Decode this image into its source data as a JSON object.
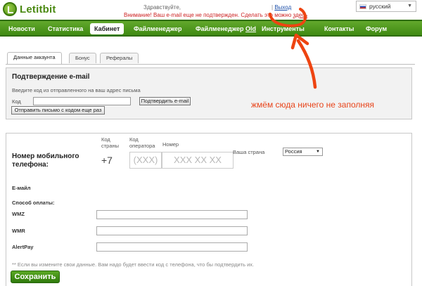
{
  "header": {
    "logo_text": "Letitbit",
    "greeting": "Здравствуйте,",
    "logout_sep": "|",
    "logout": "Выход",
    "warning_text": "Внимание! Ваш e-mail еще не подтвержден. Сделать это можно",
    "warning_link": "здесь",
    "language": "русский"
  },
  "nav": {
    "items": [
      "Новости",
      "Статистика",
      "Кабинет",
      "Файлменеджер"
    ],
    "item_old_prefix": "Файлменеджер",
    "item_old_suffix": "Old",
    "item_tools": "Инструменты",
    "item_contacts": "Контакты",
    "item_forum": "Форум"
  },
  "tabs": [
    "Данные аккаунта",
    "Бонус",
    "Рефералы"
  ],
  "email_panel": {
    "title": "Подтверждение e-mail",
    "hint": "Введите код из отправленного на ваш адрес письма",
    "code_label": "Код",
    "confirm_button": "Подтвердить e-mail",
    "resend_button": "Отправить письмо с кодом еще раз"
  },
  "annotation": "жмём сюда ничего не заполняя",
  "phone_panel": {
    "title": "Номер мобильного телефона:",
    "country_code_label": "Код страны",
    "country_code": "+7",
    "operator_code_label": "Код оператора",
    "operator_placeholder": "(XXX)",
    "number_label": "Номер",
    "number_placeholder": "XXX XX XX",
    "country_label": "Ваша страна",
    "country_value": "Россия"
  },
  "fields": {
    "email_label": "E-майл",
    "payment_label": "Способ оплаты:",
    "wmz_label": "WMZ",
    "wmr_label": "WMR",
    "alertpay_label": "AlertPay"
  },
  "note": "** Если вы измените свои данные. Вам надо будет ввести код с телефона, что бы подтвердить их.",
  "save_button": "Сохранить",
  "colors": {
    "nav_green": "#4f9a1c",
    "annotation_red": "#e8441a",
    "warning_red": "#cc2222"
  }
}
